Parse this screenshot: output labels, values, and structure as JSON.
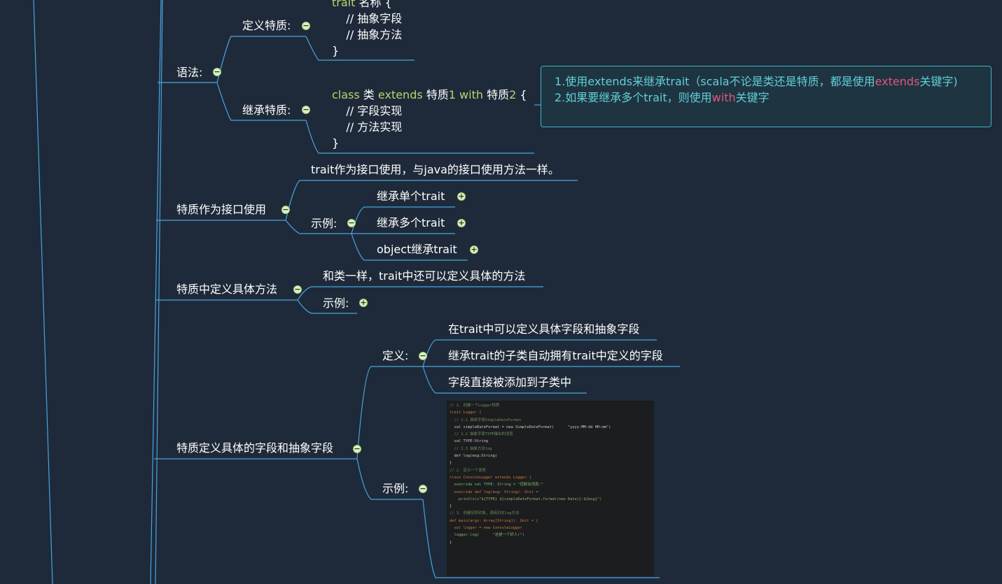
{
  "nodes": {
    "syntax": "语法:",
    "define_trait": "定义特质:",
    "inherit_trait": "继承特质:",
    "as_interface": "特质作为接口使用",
    "as_interface_desc": "trait作为接口使用，与java的接口使用方法一样。",
    "example": "示例:",
    "single_trait": "继承单个trait",
    "multi_trait": "继承多个trait",
    "object_trait": "object继承trait",
    "concrete_method": "特质中定义具体方法",
    "concrete_method_desc": "和类一样，trait中还可以定义具体的方法",
    "fields": "特质定义具体的字段和抽象字段",
    "definition": "定义:",
    "fields_desc_1": "在trait中可以定义具体字段和抽象字段",
    "fields_desc_2": "继承trait的子类自动拥有trait中定义的字段",
    "fields_desc_3": "字段直接被添加到子类中"
  },
  "code_define": {
    "line1_kw": "trait",
    "line1_rest": " 名称 {",
    "line2": "    // 抽象字段",
    "line3": "    // 抽象方法",
    "line4": "}"
  },
  "code_inherit": {
    "kw_class": "class",
    "class_name": " 类 ",
    "kw_extends": "extends",
    "trait1": " 特质",
    "num1": "1",
    "kw_with": " with",
    "trait2": " 特质",
    "num2": "2",
    "brace": " {",
    "line2": "    // 字段实现",
    "line3": "    // 方法实现",
    "line4": "}"
  },
  "note": {
    "line1_a": "1.使用extends来继承trait（scala不论是类还是特质，都是使用",
    "line1_kw": "extends",
    "line1_b": "关键字)",
    "line2_a": "2.如果要继承多个trait，则使用",
    "line2_kw": "with",
    "line2_b": "关键字"
  },
  "code_image": {
    "lines": [
      "// 1. 创建一个Logger特质",
      "trait Logger {",
      "  // 1.1 具体字段SimpleDateFormat",
      "  val simpleDateFormat = new SimpleDateFormat(      \"yyyy-MM-dd HH:mm\")",
      "  // 1.2 抽象字段TYPE输出的消息",
      "  val TYPE:String",
      "  // 1.3 抽象方法log",
      "  def log(msg:String)",
      "",
      "}",
      "",
      "// 2. 定义一个该类",
      "class ConsoleLogger extends Logger {",
      "  override val TYPE: String = \"控制台消息:\"",
      "",
      "  override def log(msg: String): Unit =",
      "    println(s\"${TYPE} ${simpleDateFormat.format(new Date)}:${msg}\")",
      "}",
      "",
      "// 3. 创建实例对象，调用日志log方法",
      "def main(args: Array[String]): Unit = {",
      "  val logger = new ConsoleLogger",
      "  logger.log(      \"这是一个好人!\")",
      "}"
    ]
  },
  "colors": {
    "background": "#1e2a39",
    "line": "#4aa3df",
    "keyword": "#b7d56e",
    "highlight": "#e0567e",
    "note_text": "#5fd1d8",
    "note_border": "#3fb6c0",
    "toggle_fill": "#dff0c8",
    "toggle_border": "#9ccf6b"
  },
  "toggles": {
    "collapse": "−",
    "expand": "+"
  }
}
